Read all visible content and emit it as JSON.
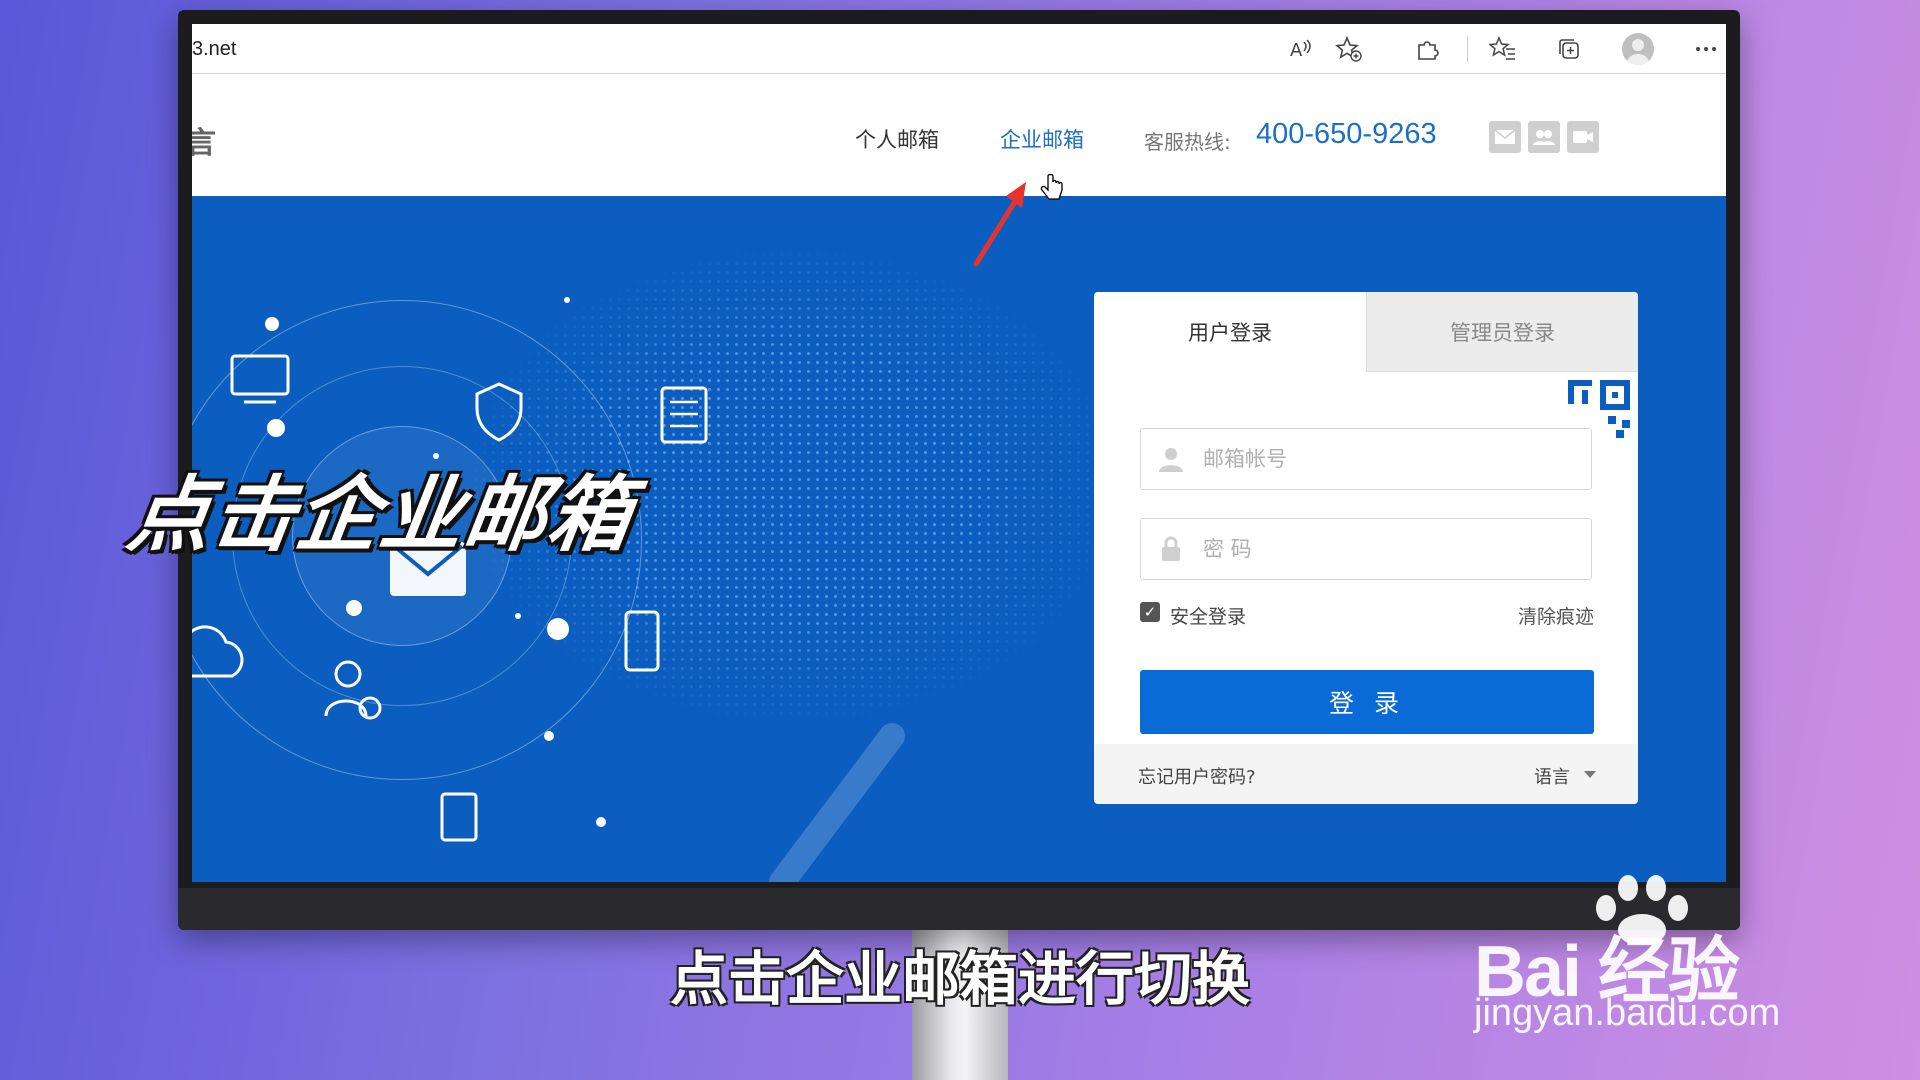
{
  "browser": {
    "url_fragment": "3.net",
    "colors": {
      "accent": "#1b6fc4"
    }
  },
  "site": {
    "logo_fragment": "言",
    "nav": {
      "personal": "个人邮箱",
      "enterprise": "企业邮箱"
    },
    "hotline_label": "客服热线:",
    "hotline_number": "400-650-9263",
    "header_icons": [
      "mail-icon",
      "group-icon",
      "video-icon"
    ],
    "banner_color": "#0b5ebf"
  },
  "login": {
    "tabs": {
      "user": "用户登录",
      "admin": "管理员登录"
    },
    "username_placeholder": "邮箱帐号",
    "password_placeholder": "密 码",
    "secure_login_label": "安全登录",
    "secure_login_checked": true,
    "clear_traces": "清除痕迹",
    "submit": "登 录",
    "forgot": "忘记用户密码?",
    "language": "语言",
    "button_color": "#0a6ad6"
  },
  "overlay": {
    "big_caption": "点击企业邮箱",
    "subtitle": "点击企业邮箱进行切换",
    "watermark_logo": "Bai  经验",
    "watermark_url": "jingyan.baidu.com"
  }
}
